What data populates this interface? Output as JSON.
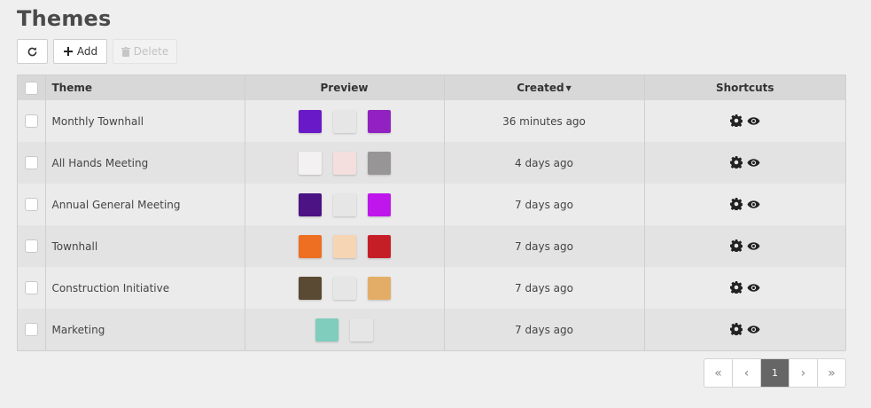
{
  "page": {
    "title": "Themes"
  },
  "toolbar": {
    "refresh_icon": "refresh-icon",
    "add_label": "Add",
    "add_icon": "plus-icon",
    "delete_label": "Delete",
    "delete_icon": "trash-icon"
  },
  "table": {
    "columns": {
      "theme": "Theme",
      "preview": "Preview",
      "created": "Created",
      "shortcuts": "Shortcuts"
    },
    "sort": {
      "column": "created",
      "direction": "descending"
    },
    "shortcut_icons": [
      "gear-icon",
      "eye-icon"
    ],
    "rows": [
      {
        "name": "Monthly Townhall",
        "created": "36 minutes ago",
        "colors": [
          "#6a19c8",
          "#e6e6e6",
          "#9121c1"
        ]
      },
      {
        "name": "All Hands Meeting",
        "created": "4 days ago",
        "colors": [
          "#f3f1f1",
          "#f4dede",
          "#979595"
        ]
      },
      {
        "name": "Annual General Meeting",
        "created": "7 days ago",
        "colors": [
          "#4b1383",
          "#e6e6e6",
          "#bf16ec"
        ]
      },
      {
        "name": "Townhall",
        "created": "7 days ago",
        "colors": [
          "#ee6e22",
          "#f6d5b4",
          "#c61e26"
        ]
      },
      {
        "name": "Construction Initiative",
        "created": "7 days ago",
        "colors": [
          "#5a4a33",
          "#e6e6e6",
          "#e4ad67"
        ]
      },
      {
        "name": "Marketing",
        "created": "7 days ago",
        "colors": [
          "#80cdbd",
          "#e6e6e6"
        ]
      }
    ]
  },
  "pagination": {
    "first": "«",
    "prev": "‹",
    "current": "1",
    "next": "›",
    "last": "»"
  }
}
